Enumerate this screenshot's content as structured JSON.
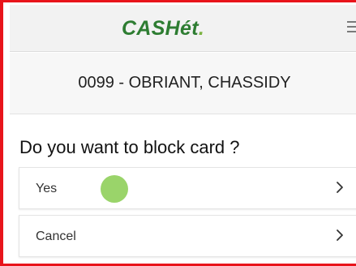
{
  "header": {
    "logo_text": "CASHét",
    "logo_dot": ".",
    "menu_icon": "hamburger-menu-icon"
  },
  "account": {
    "name": "0099 - OBRIANT, CHASSIDY"
  },
  "prompt": {
    "question": "Do you want to block card ?"
  },
  "options": [
    {
      "label": "Yes",
      "icon": "chevron-right-icon"
    },
    {
      "label": "Cancel",
      "icon": "chevron-right-icon"
    }
  ],
  "colors": {
    "frame_border": "#e8141b",
    "logo": "#2e7d32",
    "tap_indicator": "#8fcf5a"
  }
}
